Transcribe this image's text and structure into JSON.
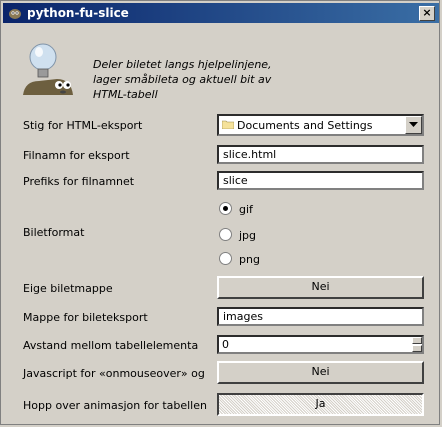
{
  "window": {
    "title": "python-fu-slice",
    "close_label": "×"
  },
  "description": {
    "lines": [
      "Deler biletet langs hjelpelinjene,",
      "lager småbileta og aktuell bit av",
      "HTML-tabell"
    ]
  },
  "fields": {
    "html_path": {
      "label": "Stig for HTML-eksport",
      "value": "Documents and Settings",
      "icon": "folder-icon"
    },
    "filename": {
      "label": "Filnamn for eksport",
      "value": "slice.html"
    },
    "prefix": {
      "label": "Prefiks for filnamnet",
      "value": "slice"
    },
    "image_format": {
      "label": "Biletformat",
      "options": [
        "gif",
        "jpg",
        "png"
      ],
      "selected": "gif"
    },
    "separate_dir": {
      "label": "Eige biletmappe",
      "value": "Nei"
    },
    "image_dir": {
      "label": "Mappe for bileteksport",
      "value": "images"
    },
    "spacing": {
      "label": "Avstand mellom tabellelementa",
      "value": "0"
    },
    "javascript": {
      "label": "Javascript for «onmouseover» og",
      "value": "Nei"
    },
    "skip_animation": {
      "label": "Hopp over animasjon for tabellen",
      "value": "Ja"
    }
  }
}
